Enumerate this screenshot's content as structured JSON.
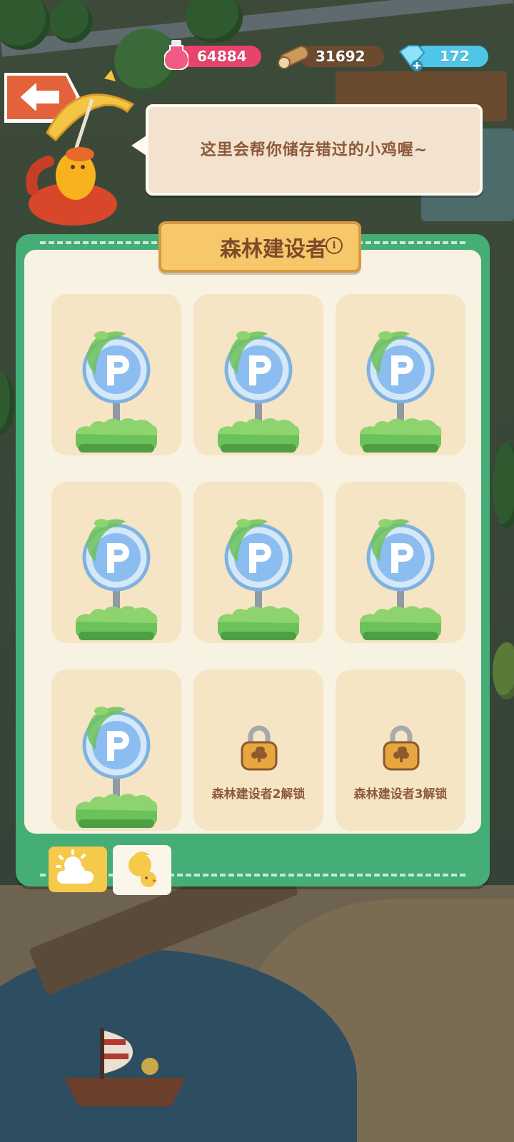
{
  "resources": {
    "potion": {
      "value": "64884",
      "icon": "potion-icon",
      "color": "#e8436b"
    },
    "wood": {
      "value": "31692",
      "icon": "wood-log-icon",
      "color": "#8a5a36"
    },
    "gems": {
      "value": "172",
      "icon": "gem-icon",
      "color": "#4fc6e8"
    }
  },
  "header": {
    "back_icon": "back-arrow-icon"
  },
  "speech": {
    "text": "这里会帮你储存错过的小鸡喔~"
  },
  "panel": {
    "title": "森林建设者",
    "info_icon": "info-icon",
    "info_glyph": "i",
    "slots": [
      {
        "state": "unlocked",
        "item": "parking-sign"
      },
      {
        "state": "unlocked",
        "item": "parking-sign"
      },
      {
        "state": "unlocked",
        "item": "parking-sign"
      },
      {
        "state": "unlocked",
        "item": "parking-sign"
      },
      {
        "state": "unlocked",
        "item": "parking-sign"
      },
      {
        "state": "unlocked",
        "item": "parking-sign"
      },
      {
        "state": "unlocked",
        "item": "parking-sign"
      },
      {
        "state": "locked",
        "label": "森林建设者2解锁"
      },
      {
        "state": "locked",
        "label": "森林建设者3解锁"
      }
    ],
    "tabs": [
      {
        "icon": "weather-icon",
        "active": false
      },
      {
        "icon": "chick-icon",
        "active": true
      }
    ]
  },
  "colors": {
    "panel_green": "#45ad76",
    "panel_inner": "#f8f2e2",
    "slot_bg": "#f5e5c5",
    "title_bg": "#f7c86a",
    "text_brown": "#8c5a3a"
  }
}
